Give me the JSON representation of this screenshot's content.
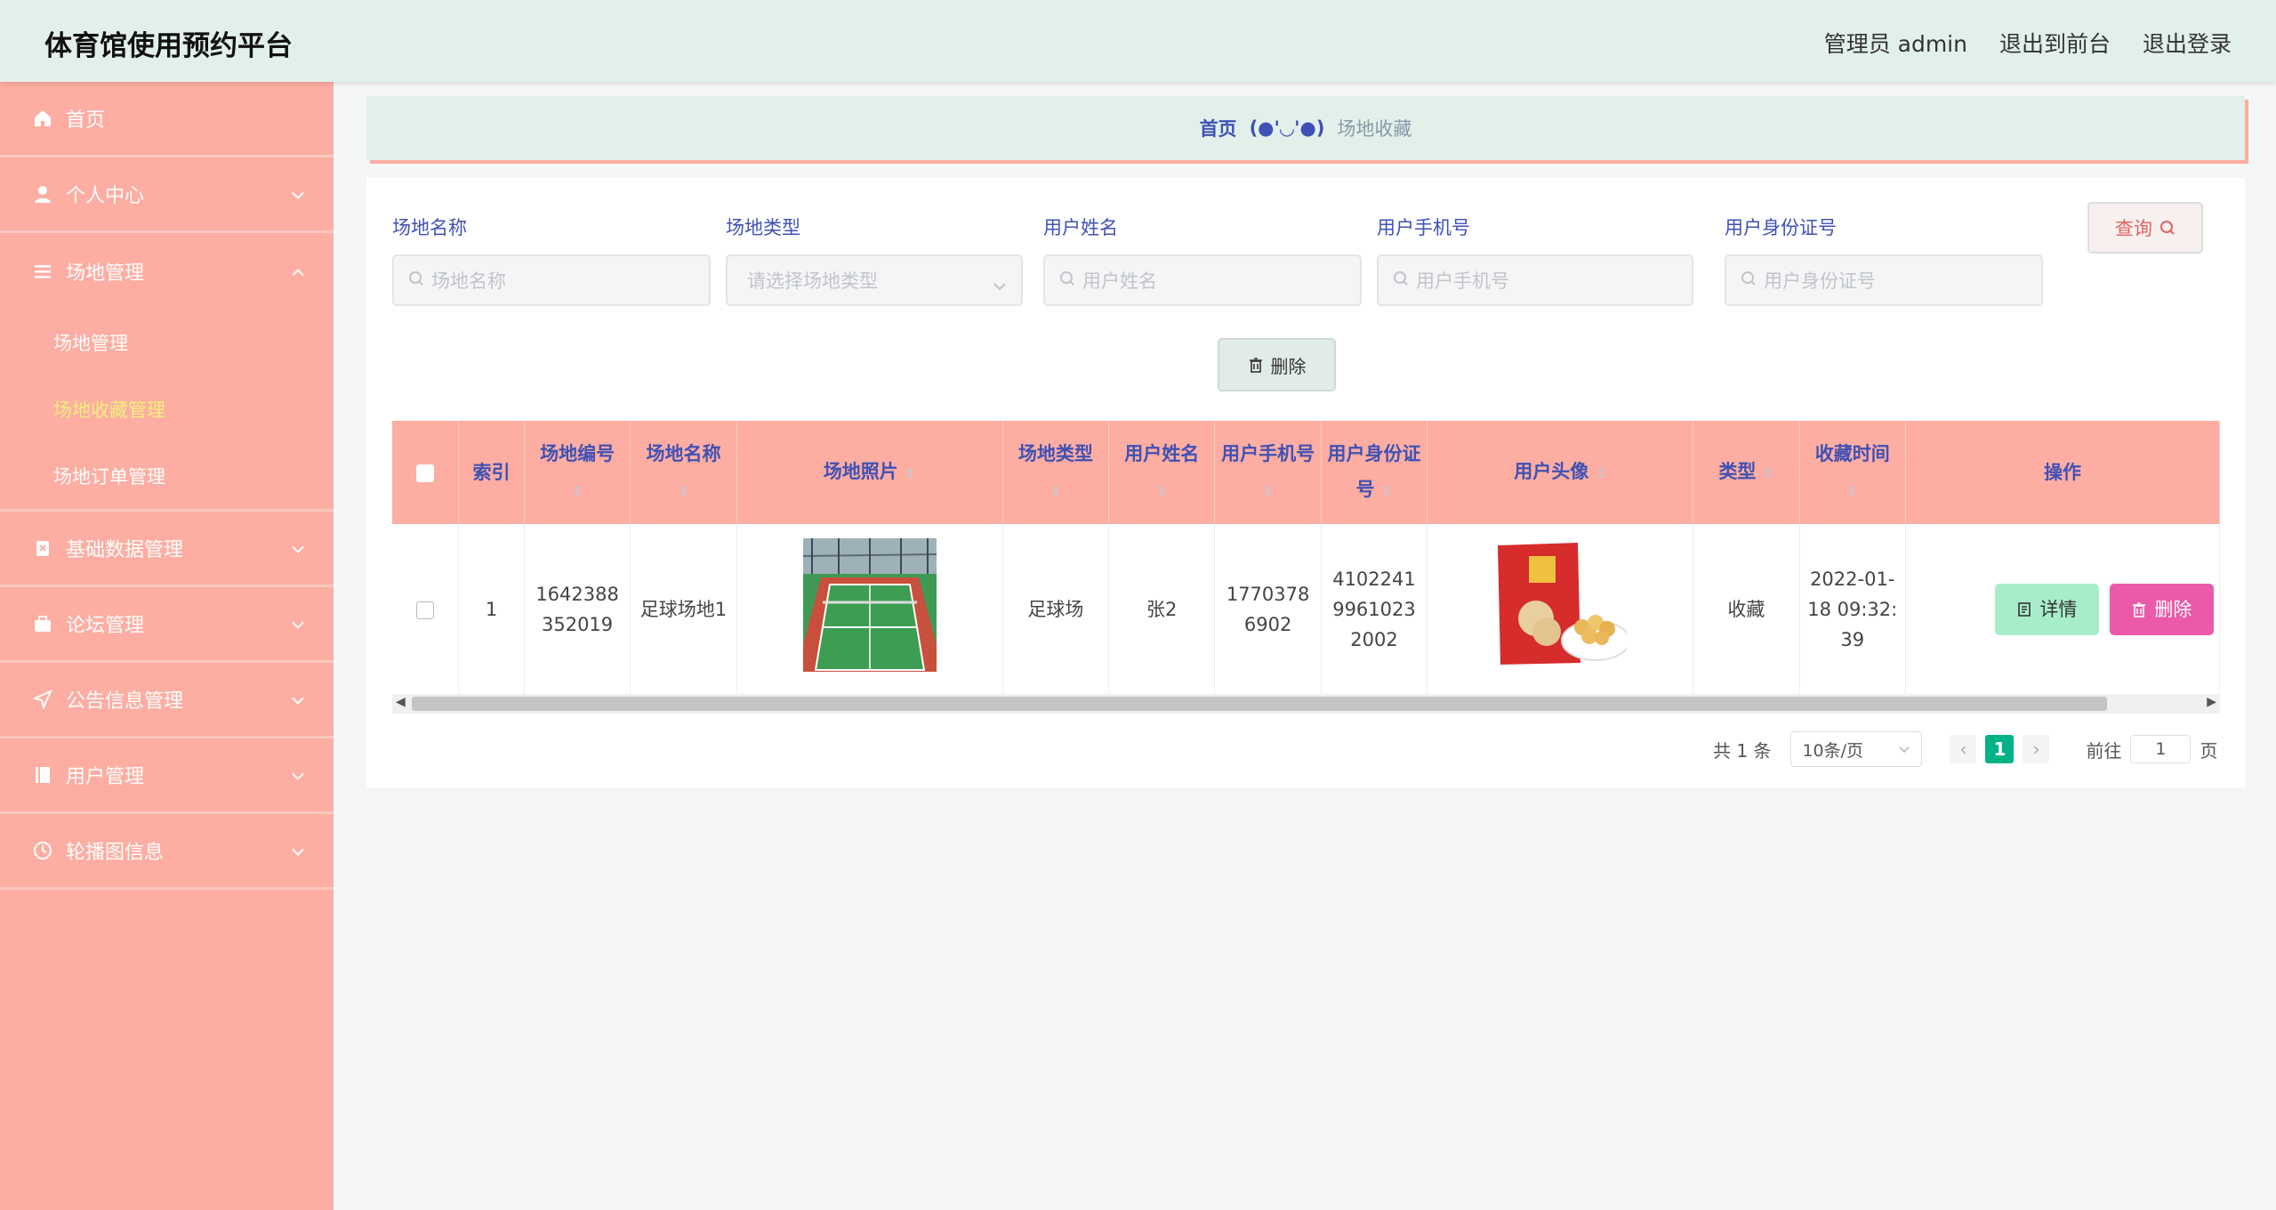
{
  "header": {
    "title": "体育馆使用预约平台",
    "user": "管理员 admin",
    "to_front": "退出到前台",
    "logout": "退出登录"
  },
  "sidebar": {
    "items": [
      {
        "label": "首页",
        "icon": "home-icon"
      },
      {
        "label": "个人中心",
        "icon": "user-icon"
      },
      {
        "label": "场地管理",
        "icon": "list-icon",
        "expanded": true,
        "children": [
          {
            "label": "场地管理"
          },
          {
            "label": "场地收藏管理",
            "active": true
          },
          {
            "label": "场地订单管理"
          }
        ]
      },
      {
        "label": "基础数据管理",
        "icon": "trash-icon"
      },
      {
        "label": "论坛管理",
        "icon": "briefcase-icon"
      },
      {
        "label": "公告信息管理",
        "icon": "send-icon"
      },
      {
        "label": "用户管理",
        "icon": "notebook-icon"
      },
      {
        "label": "轮播图信息",
        "icon": "clock-icon"
      }
    ],
    "active_color": "#f3f07a"
  },
  "breadcrumb": {
    "home": "首页",
    "sep": "(●'◡'●)",
    "current": "场地收藏"
  },
  "filters": {
    "venue_name": {
      "label": "场地名称",
      "placeholder": "场地名称"
    },
    "venue_type": {
      "label": "场地类型",
      "placeholder": "请选择场地类型"
    },
    "user_name": {
      "label": "用户姓名",
      "placeholder": "用户姓名"
    },
    "user_phone": {
      "label": "用户手机号",
      "placeholder": "用户手机号"
    },
    "user_id": {
      "label": "用户身份证号",
      "placeholder": "用户身份证号"
    },
    "query_label": "查询",
    "delete_label": "删除"
  },
  "table": {
    "headers": {
      "index": "索引",
      "venue_no": "场地编号",
      "venue_name": "场地名称",
      "venue_photo": "场地照片",
      "venue_type": "场地类型",
      "user_name": "用户姓名",
      "user_phone": "用户手机号",
      "user_id": "用户身份证号",
      "avatar": "用户头像",
      "type": "类型",
      "fav_time": "收藏时间",
      "actions": "操作"
    },
    "rows": [
      {
        "index": "1",
        "venue_no": "1642388352019",
        "venue_name": "足球场地1",
        "venue_type": "足球场",
        "user_name": "张2",
        "user_phone": "17703786902",
        "user_id": "410224199610232002",
        "type": "收藏",
        "fav_time": "2022-01-18 09:32:39",
        "detail_label": "详情",
        "delete_label": "删除"
      }
    ]
  },
  "pagination": {
    "total": "共 1 条",
    "page_size": "10条/页",
    "current_page": "1",
    "goto_label": "前往",
    "goto_value": "1",
    "page_suffix": "页"
  }
}
